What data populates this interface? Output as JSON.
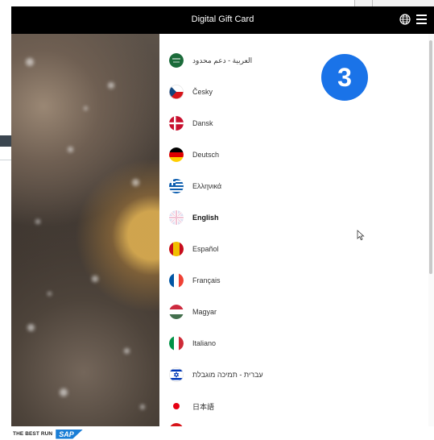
{
  "app": {
    "title": "Digital Gift Card"
  },
  "icons": {
    "globe": "globe-icon",
    "menu": "hamburger-menu-icon"
  },
  "languages": [
    {
      "label": "العربية - دعم محدود",
      "flag": "saudi-arabia",
      "active": false
    },
    {
      "label": "Česky",
      "flag": "czech",
      "active": false
    },
    {
      "label": "Dansk",
      "flag": "denmark",
      "active": false
    },
    {
      "label": "Deutsch",
      "flag": "germany",
      "active": false
    },
    {
      "label": "Ελληνικά",
      "flag": "greece",
      "active": false
    },
    {
      "label": "English",
      "flag": "uk",
      "active": true
    },
    {
      "label": "Español",
      "flag": "spain",
      "active": false
    },
    {
      "label": "Français",
      "flag": "france",
      "active": false
    },
    {
      "label": "Magyar",
      "flag": "hungary",
      "active": false
    },
    {
      "label": "Italiano",
      "flag": "italy",
      "active": false
    },
    {
      "label": "עברית - תמיכה מוגבלת",
      "flag": "israel",
      "active": false
    },
    {
      "label": "日本語",
      "flag": "japan",
      "active": false
    }
  ],
  "annotation": {
    "step": "3",
    "color": "#1a73e8"
  },
  "footer": {
    "tagline": "THE BEST RUN",
    "brand": "SAP"
  }
}
